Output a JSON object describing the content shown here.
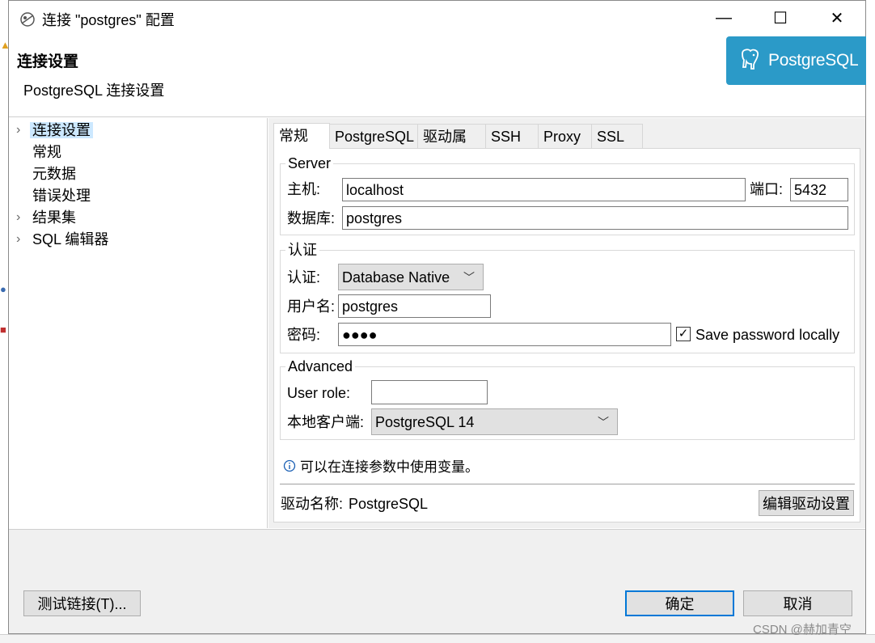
{
  "window": {
    "title": "连接 \"postgres\" 配置",
    "minimize_glyph": "—",
    "maximize_glyph": "☐",
    "close_glyph": "✕",
    "app_icon": "dbeaver-beaver-icon"
  },
  "header": {
    "title": "连接设置",
    "subtitle": "PostgreSQL 连接设置",
    "logo_text": "PostgreSQL",
    "logo_color": "#2b9ac8"
  },
  "nav": {
    "items": [
      {
        "label": "连接设置",
        "expandable": true,
        "selected": true
      },
      {
        "label": "常规",
        "expandable": false
      },
      {
        "label": "元数据",
        "expandable": false
      },
      {
        "label": "错误处理",
        "expandable": false
      },
      {
        "label": "结果集",
        "expandable": true
      },
      {
        "label": "SQL 编辑器",
        "expandable": true
      }
    ]
  },
  "tabs": [
    "常规",
    "PostgreSQL",
    "驱动属性",
    "SSH",
    "Proxy",
    "SSL"
  ],
  "server": {
    "legend": "Server",
    "host_label": "主机:",
    "host_value": "localhost",
    "port_label": "端口:",
    "port_value": "5432",
    "database_label": "数据库:",
    "database_value": "postgres"
  },
  "auth": {
    "legend": "认证",
    "auth_label": "认证:",
    "auth_value": "Database Native",
    "username_label": "用户名:",
    "username_value": "postgres",
    "password_label": "密码:",
    "password_value": "●●●●",
    "save_password_label": "Save password locally",
    "save_password_checked": true
  },
  "advanced": {
    "legend": "Advanced",
    "user_role_label": "User role:",
    "user_role_value": "",
    "local_client_label": "本地客户端:",
    "local_client_value": "PostgreSQL 14"
  },
  "info_text": "可以在连接参数中使用变量。",
  "driver": {
    "label": "驱动名称:",
    "value": "PostgreSQL",
    "edit_button": "编辑驱动设置"
  },
  "footer": {
    "test_button": "测试链接(T)...",
    "ok_button": "确定",
    "cancel_button": "取消"
  },
  "watermark": "CSDN @赫加青空",
  "accent_color": "#0078d7"
}
